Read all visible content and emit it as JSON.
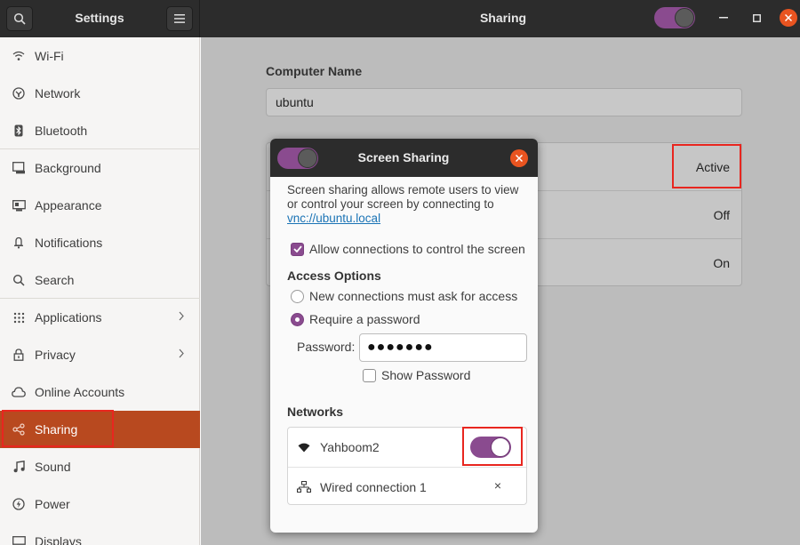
{
  "app": {
    "sidebar_title": "Settings",
    "main_title": "Sharing"
  },
  "sidebar": {
    "items": [
      {
        "label": "Wi-Fi",
        "icon": "wifi-icon"
      },
      {
        "label": "Network",
        "icon": "network-icon"
      },
      {
        "label": "Bluetooth",
        "icon": "bluetooth-icon"
      },
      {
        "label": "Background",
        "icon": "background-icon"
      },
      {
        "label": "Appearance",
        "icon": "appearance-icon"
      },
      {
        "label": "Notifications",
        "icon": "notifications-icon"
      },
      {
        "label": "Search",
        "icon": "search-icon"
      },
      {
        "label": "Applications",
        "icon": "applications-icon"
      },
      {
        "label": "Privacy",
        "icon": "privacy-icon"
      },
      {
        "label": "Online Accounts",
        "icon": "online-accounts-icon"
      },
      {
        "label": "Sharing",
        "icon": "sharing-icon"
      },
      {
        "label": "Sound",
        "icon": "sound-icon"
      },
      {
        "label": "Power",
        "icon": "power-icon"
      },
      {
        "label": "Displays",
        "icon": "displays-icon"
      }
    ],
    "active": "Sharing"
  },
  "main": {
    "computer_name_label": "Computer Name",
    "computer_name_value": "ubuntu",
    "rows": [
      {
        "status": "Active"
      },
      {
        "status": "Off"
      },
      {
        "status": "On"
      }
    ]
  },
  "dialog": {
    "title": "Screen Sharing",
    "description": "Screen sharing allows remote users to view or control your screen by connecting to",
    "link": "vnc://ubuntu.local",
    "allow_control_label": "Allow connections to control the screen",
    "allow_control_checked": true,
    "access_options_heading": "Access Options",
    "radio_ask": "New connections must ask for access",
    "radio_password": "Require a password",
    "selected_option": "Require a password",
    "password_label": "Password:",
    "password_value": "●●●●●●●",
    "show_password_label": "Show Password",
    "show_password_checked": false,
    "networks_heading": "Networks",
    "networks": [
      {
        "name": "Yahboom2",
        "icon": "wifi-icon",
        "enabled": true
      },
      {
        "name": "Wired connection 1",
        "icon": "wired-network-icon",
        "remove": "×"
      }
    ]
  },
  "colors": {
    "accent": "#8a4b8f",
    "active_sidebar": "#b8491f",
    "close": "#e95420",
    "annotation": "#e8261f"
  }
}
